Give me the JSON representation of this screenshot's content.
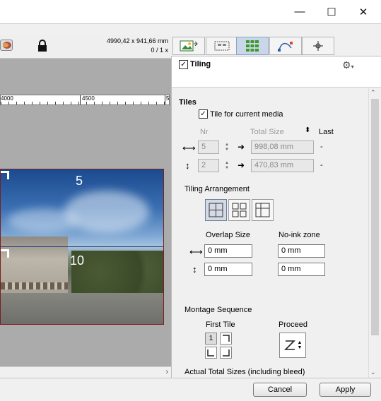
{
  "window": {
    "minimize_glyph": "—",
    "maximize_glyph": "☐",
    "close_glyph": "✕"
  },
  "infobar": {
    "dimensions": "4990,42 x 941,66 mm",
    "page": "0 / 1 x"
  },
  "ruler": {
    "ticks": [
      "4000",
      "4500",
      "5"
    ]
  },
  "preview": {
    "tile_labels": [
      "5",
      "10"
    ]
  },
  "tabs": [
    {
      "icon": "image-placement-icon"
    },
    {
      "icon": "layout-icon"
    },
    {
      "icon": "tiling-grid-icon",
      "active": true
    },
    {
      "icon": "path-edit-icon"
    },
    {
      "icon": "crosshair-icon"
    }
  ],
  "panel": {
    "title": "Tiling",
    "tiling_checked": true,
    "tiles_heading": "Tiles",
    "tile_for_media_label": "Tile for current media",
    "tile_for_media_checked": true,
    "col_nr": "Nr",
    "col_total_size": "Total Size",
    "col_last": "Last",
    "horizontal": {
      "nr": "5",
      "total": "998,08 mm",
      "last": "-"
    },
    "vertical": {
      "nr": "2",
      "total": "470,83 mm",
      "last": "-"
    },
    "arrangement_heading": "Tiling Arrangement",
    "overlap_label": "Overlap Size",
    "noink_label": "No-ink zone",
    "overlap_h": "0 mm",
    "overlap_v": "0 mm",
    "noink_h": "0 mm",
    "noink_v": "0 mm",
    "montage_heading": "Montage Sequence",
    "first_tile_label": "First Tile",
    "proceed_label": "Proceed",
    "first_tile_selected": "1",
    "actual_sizes_heading": "Actual Total Sizes (including bleed)"
  },
  "buttons": {
    "cancel": "Cancel",
    "apply": "Apply"
  },
  "colors": {
    "accent_tab": "#c9d7e8",
    "photo_border": "#7a1f1f"
  }
}
